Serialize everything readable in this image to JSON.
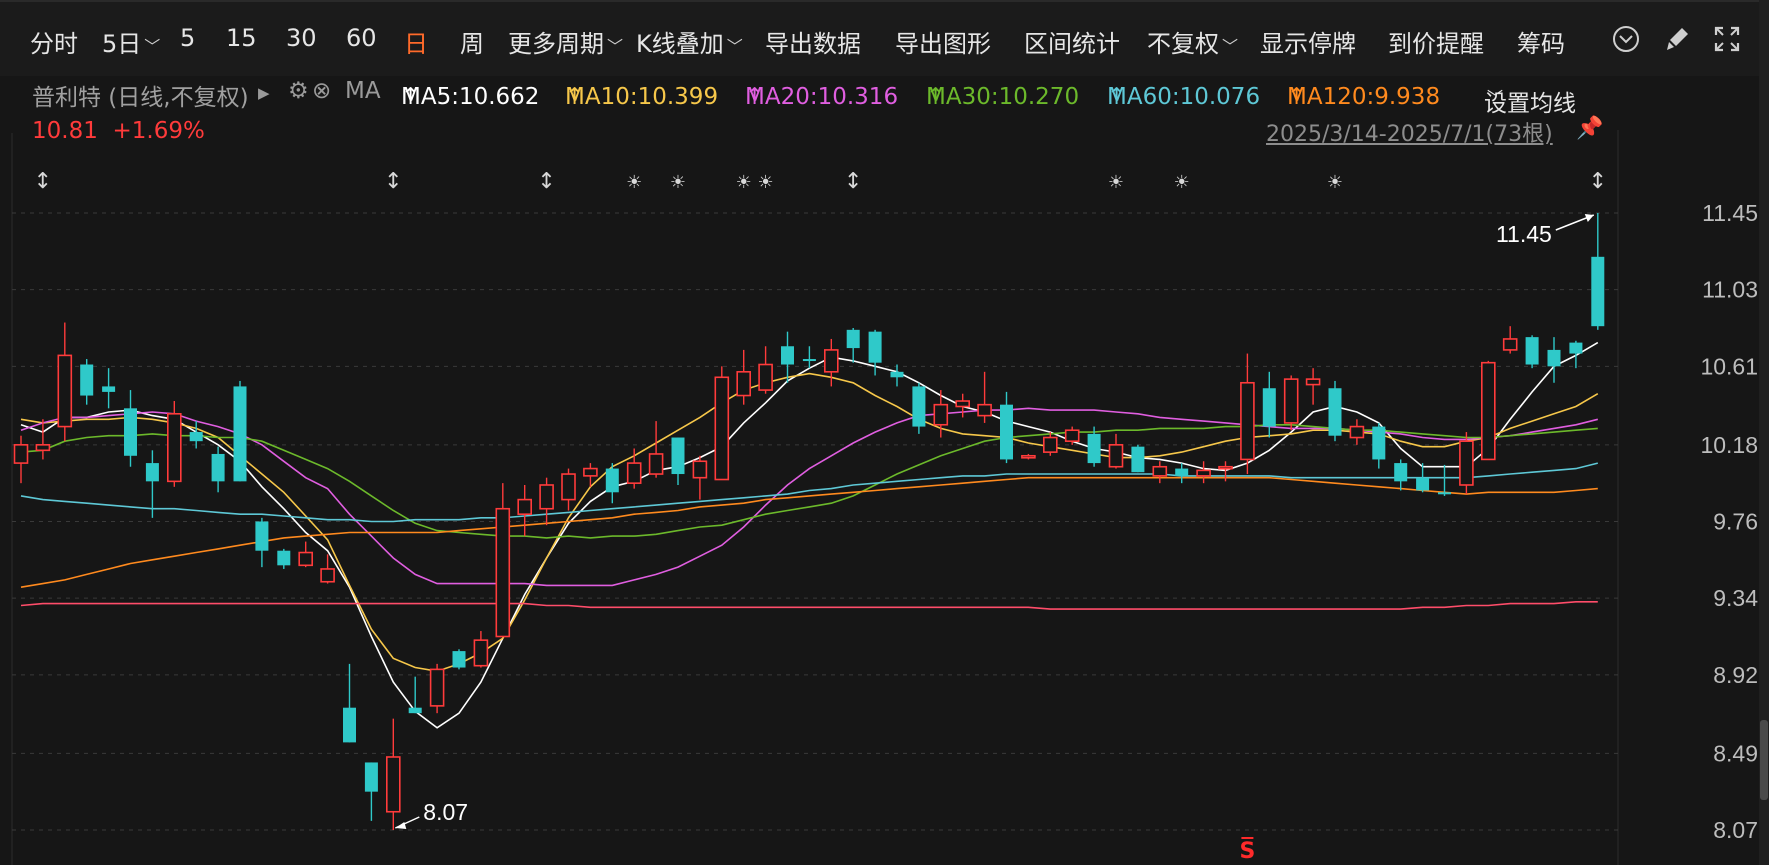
{
  "toolbar": {
    "items": [
      {
        "label": "分时",
        "chev": ""
      },
      {
        "label": "5日",
        "chev": "﹀"
      },
      {
        "label": "5",
        "chev": ""
      },
      {
        "label": "15",
        "chev": ""
      },
      {
        "label": "30",
        "chev": ""
      },
      {
        "label": "60",
        "chev": ""
      },
      {
        "label": "日",
        "chev": "",
        "active": true
      },
      {
        "label": "周",
        "chev": ""
      },
      {
        "label": "更多周期",
        "chev": "﹀"
      },
      {
        "label": "K线叠加",
        "chev": "﹀"
      },
      {
        "label": "导出数据",
        "chev": ""
      },
      {
        "label": "导出图形",
        "chev": ""
      },
      {
        "label": "区间统计",
        "chev": ""
      },
      {
        "label": "不复权",
        "chev": "﹀"
      },
      {
        "label": "显示停牌",
        "chev": ""
      },
      {
        "label": "到价提醒",
        "chev": ""
      },
      {
        "label": "筹码",
        "chev": ""
      }
    ],
    "icons": [
      "chevron-circle-icon",
      "brush-icon",
      "expand-icon"
    ]
  },
  "legend": {
    "stock": "普利特 (日线,不复权)",
    "ma_label": "MA",
    "settings": "设置均线",
    "mas": [
      {
        "text": "MA5:10.662",
        "color": "#ffffff"
      },
      {
        "text": "MA10:10.399",
        "color": "#f6c74a"
      },
      {
        "text": "MA20:10.316",
        "color": "#e05ee0"
      },
      {
        "text": "MA30:10.270",
        "color": "#6cb92b"
      },
      {
        "text": "MA60:10.076",
        "color": "#5ec8d6"
      },
      {
        "text": "MA120:9.938",
        "color": "#ff8a1e"
      }
    ]
  },
  "price": "10.81",
  "change": "+1.69%",
  "range_text": "2025/3/14-2025/7/1(73根)",
  "colors": {
    "up": "#ff3b3b",
    "down": "#2fc9c9",
    "grid": "#3a3a3a",
    "axis_text": "#bdbdbd"
  },
  "chart_data": {
    "type": "candlestick",
    "y_ticks": [
      11.45,
      11.03,
      10.61,
      10.18,
      9.76,
      9.34,
      8.92,
      8.49,
      8.07
    ],
    "ylim": [
      8.07,
      11.45
    ],
    "max_label": "11.45",
    "min_label": "8.07",
    "candles": [
      {
        "o": 10.08,
        "c": 10.18,
        "h": 10.23,
        "l": 9.97
      },
      {
        "o": 10.15,
        "c": 10.18,
        "h": 10.32,
        "l": 10.1
      },
      {
        "o": 10.28,
        "c": 10.67,
        "h": 10.85,
        "l": 10.2
      },
      {
        "o": 10.62,
        "c": 10.45,
        "h": 10.65,
        "l": 10.4
      },
      {
        "o": 10.5,
        "c": 10.47,
        "h": 10.6,
        "l": 10.38
      },
      {
        "o": 10.38,
        "c": 10.12,
        "h": 10.48,
        "l": 10.06
      },
      {
        "o": 10.08,
        "c": 9.98,
        "h": 10.15,
        "l": 9.78
      },
      {
        "o": 9.98,
        "c": 10.35,
        "h": 10.42,
        "l": 9.95
      },
      {
        "o": 10.25,
        "c": 10.2,
        "h": 10.31,
        "l": 10.16
      },
      {
        "o": 10.13,
        "c": 9.98,
        "h": 10.17,
        "l": 9.92
      },
      {
        "o": 10.5,
        "c": 9.98,
        "h": 10.53,
        "l": 9.98
      },
      {
        "o": 9.76,
        "c": 9.6,
        "h": 9.78,
        "l": 9.51
      },
      {
        "o": 9.6,
        "c": 9.52,
        "h": 9.61,
        "l": 9.5
      },
      {
        "o": 9.52,
        "c": 9.59,
        "h": 9.65,
        "l": 9.51
      },
      {
        "o": 9.43,
        "c": 9.5,
        "h": 9.58,
        "l": 9.42
      },
      {
        "o": 8.74,
        "c": 8.55,
        "h": 8.98,
        "l": 8.55
      },
      {
        "o": 8.44,
        "c": 8.28,
        "h": 8.44,
        "l": 8.12
      },
      {
        "o": 8.17,
        "c": 8.47,
        "h": 8.68,
        "l": 8.07
      },
      {
        "o": 8.74,
        "c": 8.71,
        "h": 8.91,
        "l": 8.71
      },
      {
        "o": 8.75,
        "c": 8.95,
        "h": 8.98,
        "l": 8.71
      },
      {
        "o": 9.05,
        "c": 8.96,
        "h": 9.06,
        "l": 8.95
      },
      {
        "o": 8.97,
        "c": 9.11,
        "h": 9.16,
        "l": 8.96
      },
      {
        "o": 9.13,
        "c": 9.83,
        "h": 9.97,
        "l": 9.13
      },
      {
        "o": 9.8,
        "c": 9.88,
        "h": 9.96,
        "l": 9.68
      },
      {
        "o": 9.83,
        "c": 9.96,
        "h": 10.0,
        "l": 9.74
      },
      {
        "o": 9.88,
        "c": 10.02,
        "h": 10.05,
        "l": 9.82
      },
      {
        "o": 10.01,
        "c": 10.05,
        "h": 10.08,
        "l": 9.95
      },
      {
        "o": 10.05,
        "c": 9.92,
        "h": 10.08,
        "l": 9.86
      },
      {
        "o": 9.97,
        "c": 10.08,
        "h": 10.16,
        "l": 9.94
      },
      {
        "o": 10.02,
        "c": 10.13,
        "h": 10.31,
        "l": 10.0
      },
      {
        "o": 10.22,
        "c": 10.02,
        "h": 10.22,
        "l": 9.96
      },
      {
        "o": 10.0,
        "c": 10.09,
        "h": 10.12,
        "l": 9.88
      },
      {
        "o": 9.99,
        "c": 10.55,
        "h": 10.61,
        "l": 9.99
      },
      {
        "o": 10.45,
        "c": 10.58,
        "h": 10.7,
        "l": 10.4
      },
      {
        "o": 10.48,
        "c": 10.62,
        "h": 10.72,
        "l": 10.46
      },
      {
        "o": 10.72,
        "c": 10.62,
        "h": 10.8,
        "l": 10.52
      },
      {
        "o": 10.65,
        "c": 10.64,
        "h": 10.72,
        "l": 10.6
      },
      {
        "o": 10.58,
        "c": 10.7,
        "h": 10.76,
        "l": 10.5
      },
      {
        "o": 10.81,
        "c": 10.71,
        "h": 10.82,
        "l": 10.63
      },
      {
        "o": 10.8,
        "c": 10.63,
        "h": 10.81,
        "l": 10.56
      },
      {
        "o": 10.58,
        "c": 10.55,
        "h": 10.62,
        "l": 10.5
      },
      {
        "o": 10.5,
        "c": 10.28,
        "h": 10.52,
        "l": 10.24
      },
      {
        "o": 10.29,
        "c": 10.4,
        "h": 10.48,
        "l": 10.22
      },
      {
        "o": 10.39,
        "c": 10.42,
        "h": 10.46,
        "l": 10.33
      },
      {
        "o": 10.34,
        "c": 10.4,
        "h": 10.58,
        "l": 10.3
      },
      {
        "o": 10.4,
        "c": 10.1,
        "h": 10.47,
        "l": 10.08
      },
      {
        "o": 10.12,
        "c": 10.12,
        "h": 10.13,
        "l": 10.1
      },
      {
        "o": 10.14,
        "c": 10.22,
        "h": 10.25,
        "l": 10.12
      },
      {
        "o": 10.2,
        "c": 10.26,
        "h": 10.28,
        "l": 10.18
      },
      {
        "o": 10.24,
        "c": 10.08,
        "h": 10.28,
        "l": 10.06
      },
      {
        "o": 10.06,
        "c": 10.18,
        "h": 10.24,
        "l": 10.05
      },
      {
        "o": 10.17,
        "c": 10.03,
        "h": 10.18,
        "l": 10.03
      },
      {
        "o": 10.01,
        "c": 10.06,
        "h": 10.09,
        "l": 9.97
      },
      {
        "o": 10.05,
        "c": 10.01,
        "h": 10.08,
        "l": 9.97
      },
      {
        "o": 10.01,
        "c": 10.04,
        "h": 10.09,
        "l": 9.97
      },
      {
        "o": 10.05,
        "c": 10.06,
        "h": 10.09,
        "l": 9.98
      },
      {
        "o": 10.1,
        "c": 10.52,
        "h": 10.68,
        "l": 10.02
      },
      {
        "o": 10.49,
        "c": 10.28,
        "h": 10.58,
        "l": 10.22
      },
      {
        "o": 10.3,
        "c": 10.54,
        "h": 10.56,
        "l": 10.26
      },
      {
        "o": 10.51,
        "c": 10.54,
        "h": 10.6,
        "l": 10.4
      },
      {
        "o": 10.49,
        "c": 10.23,
        "h": 10.53,
        "l": 10.2
      },
      {
        "o": 10.22,
        "c": 10.28,
        "h": 10.32,
        "l": 10.18
      },
      {
        "o": 10.28,
        "c": 10.1,
        "h": 10.3,
        "l": 10.05
      },
      {
        "o": 10.08,
        "c": 9.98,
        "h": 10.1,
        "l": 9.93
      },
      {
        "o": 10.0,
        "c": 9.93,
        "h": 10.08,
        "l": 9.92
      },
      {
        "o": 9.92,
        "c": 9.91,
        "h": 10.07,
        "l": 9.9
      },
      {
        "o": 9.96,
        "c": 10.2,
        "h": 10.25,
        "l": 9.91
      },
      {
        "o": 10.1,
        "c": 10.63,
        "h": 10.64,
        "l": 10.1
      },
      {
        "o": 10.7,
        "c": 10.76,
        "h": 10.83,
        "l": 10.68
      },
      {
        "o": 10.77,
        "c": 10.62,
        "h": 10.78,
        "l": 10.6
      },
      {
        "o": 10.7,
        "c": 10.61,
        "h": 10.77,
        "l": 10.52
      },
      {
        "o": 10.74,
        "c": 10.68,
        "h": 10.75,
        "l": 10.6
      },
      {
        "o": 11.21,
        "c": 10.83,
        "h": 11.45,
        "l": 10.81
      }
    ],
    "ma_series": [
      {
        "name": "MA5",
        "color": "#ffffff",
        "values": [
          10.29,
          10.25,
          10.33,
          10.33,
          10.36,
          10.37,
          10.34,
          10.32,
          10.25,
          10.18,
          10.09,
          9.95,
          9.83,
          9.7,
          9.6,
          9.4,
          9.13,
          8.88,
          8.72,
          8.63,
          8.71,
          8.88,
          9.12,
          9.36,
          9.56,
          9.75,
          9.87,
          9.95,
          9.98,
          10.04,
          10.06,
          10.11,
          10.17,
          10.3,
          10.41,
          10.53,
          10.6,
          10.66,
          10.64,
          10.61,
          10.58,
          10.52,
          10.45,
          10.39,
          10.36,
          10.31,
          10.28,
          10.25,
          10.2,
          10.16,
          10.14,
          10.11,
          10.1,
          10.08,
          10.05,
          10.04,
          10.08,
          10.15,
          10.25,
          10.36,
          10.39,
          10.36,
          10.3,
          10.16,
          10.06,
          10.06,
          10.06,
          10.16,
          10.32,
          10.47,
          10.61,
          10.67,
          10.74
        ]
      },
      {
        "name": "MA10",
        "color": "#f6c74a",
        "values": [
          10.32,
          10.3,
          10.31,
          10.32,
          10.32,
          10.33,
          10.32,
          10.3,
          10.27,
          10.22,
          10.12,
          10.02,
          9.92,
          9.79,
          9.66,
          9.41,
          9.17,
          9.01,
          8.96,
          8.94,
          8.98,
          9.04,
          9.12,
          9.33,
          9.56,
          9.78,
          9.95,
          10.06,
          10.12,
          10.19,
          10.26,
          10.33,
          10.41,
          10.48,
          10.52,
          10.55,
          10.57,
          10.55,
          10.52,
          10.45,
          10.39,
          10.32,
          10.27,
          10.24,
          10.23,
          10.22,
          10.19,
          10.17,
          10.15,
          10.13,
          10.11,
          10.11,
          10.12,
          10.14,
          10.17,
          10.2,
          10.22,
          10.23,
          10.24,
          10.26,
          10.26,
          10.25,
          10.24,
          10.2,
          10.17,
          10.17,
          10.2,
          10.22,
          10.27,
          10.31,
          10.35,
          10.39,
          10.46
        ]
      },
      {
        "name": "MA20",
        "color": "#e05ee0",
        "values": [
          10.26,
          10.3,
          10.33,
          10.33,
          10.34,
          10.35,
          10.36,
          10.35,
          10.31,
          10.28,
          10.24,
          10.18,
          10.09,
          10.0,
          9.94,
          9.8,
          9.68,
          9.56,
          9.47,
          9.42,
          9.42,
          9.42,
          9.42,
          9.42,
          9.41,
          9.41,
          9.41,
          9.41,
          9.44,
          9.47,
          9.51,
          9.57,
          9.63,
          9.73,
          9.85,
          9.96,
          10.05,
          10.12,
          10.19,
          10.25,
          10.3,
          10.34,
          10.35,
          10.36,
          10.37,
          10.37,
          10.38,
          10.37,
          10.37,
          10.37,
          10.36,
          10.35,
          10.33,
          10.32,
          10.31,
          10.3,
          10.29,
          10.28,
          10.27,
          10.27,
          10.27,
          10.26,
          10.25,
          10.24,
          10.22,
          10.21,
          10.21,
          10.22,
          10.23,
          10.25,
          10.27,
          10.29,
          10.32
        ]
      },
      {
        "name": "MA30",
        "color": "#6cb92b",
        "values": [
          10.14,
          10.15,
          10.2,
          10.22,
          10.23,
          10.23,
          10.24,
          10.23,
          10.23,
          10.22,
          10.22,
          10.2,
          10.15,
          10.1,
          10.05,
          9.98,
          9.9,
          9.82,
          9.75,
          9.71,
          9.7,
          9.69,
          9.68,
          9.68,
          9.67,
          9.68,
          9.67,
          9.68,
          9.68,
          9.69,
          9.71,
          9.73,
          9.74,
          9.77,
          9.8,
          9.82,
          9.84,
          9.86,
          9.9,
          9.96,
          10.02,
          10.07,
          10.12,
          10.16,
          10.2,
          10.22,
          10.23,
          10.24,
          10.25,
          10.25,
          10.26,
          10.26,
          10.27,
          10.27,
          10.27,
          10.28,
          10.28,
          10.29,
          10.29,
          10.28,
          10.27,
          10.26,
          10.26,
          10.25,
          10.24,
          10.23,
          10.22,
          10.22,
          10.23,
          10.24,
          10.25,
          10.26,
          10.27
        ]
      },
      {
        "name": "MA60",
        "color": "#5ec8d6",
        "values": [
          9.9,
          9.88,
          9.87,
          9.86,
          9.85,
          9.84,
          9.83,
          9.83,
          9.82,
          9.81,
          9.8,
          9.8,
          9.79,
          9.78,
          9.77,
          9.77,
          9.76,
          9.76,
          9.77,
          9.77,
          9.77,
          9.78,
          9.78,
          9.79,
          9.8,
          9.81,
          9.82,
          9.83,
          9.84,
          9.85,
          9.86,
          9.87,
          9.88,
          9.89,
          9.9,
          9.91,
          9.93,
          9.94,
          9.96,
          9.97,
          9.98,
          9.99,
          10.0,
          10.01,
          10.01,
          10.02,
          10.02,
          10.02,
          10.02,
          10.02,
          10.02,
          10.02,
          10.02,
          10.01,
          10.01,
          10.01,
          10.01,
          10.01,
          10.0,
          10.0,
          10.0,
          10.0,
          10.0,
          10.0,
          10.0,
          10.0,
          10.0,
          10.01,
          10.02,
          10.03,
          10.04,
          10.05,
          10.08
        ]
      },
      {
        "name": "MA120",
        "color": "#ff8a1e",
        "values": [
          9.4,
          9.42,
          9.44,
          9.47,
          9.5,
          9.53,
          9.55,
          9.57,
          9.59,
          9.61,
          9.63,
          9.65,
          9.67,
          9.68,
          9.69,
          9.7,
          9.7,
          9.7,
          9.7,
          9.7,
          9.71,
          9.72,
          9.73,
          9.74,
          9.75,
          9.76,
          9.77,
          9.78,
          9.8,
          9.81,
          9.82,
          9.84,
          9.85,
          9.86,
          9.88,
          9.89,
          9.9,
          9.91,
          9.92,
          9.93,
          9.94,
          9.95,
          9.96,
          9.97,
          9.98,
          9.99,
          10.0,
          10.0,
          10.0,
          10.0,
          10.0,
          10.0,
          10.0,
          10.0,
          10.0,
          10.0,
          10.0,
          10.0,
          9.99,
          9.98,
          9.97,
          9.96,
          9.95,
          9.94,
          9.93,
          9.92,
          9.91,
          9.92,
          9.92,
          9.92,
          9.92,
          9.93,
          9.94
        ]
      },
      {
        "name": "",
        "color": "#ff4d6a",
        "values": [
          9.3,
          9.31,
          9.31,
          9.31,
          9.31,
          9.31,
          9.31,
          9.31,
          9.31,
          9.31,
          9.31,
          9.31,
          9.31,
          9.31,
          9.31,
          9.31,
          9.31,
          9.31,
          9.31,
          9.31,
          9.31,
          9.31,
          9.31,
          9.31,
          9.3,
          9.3,
          9.29,
          9.29,
          9.29,
          9.29,
          9.29,
          9.29,
          9.29,
          9.29,
          9.29,
          9.29,
          9.29,
          9.29,
          9.29,
          9.29,
          9.29,
          9.29,
          9.29,
          9.29,
          9.29,
          9.29,
          9.29,
          9.28,
          9.28,
          9.28,
          9.28,
          9.28,
          9.28,
          9.28,
          9.28,
          9.28,
          9.28,
          9.28,
          9.28,
          9.28,
          9.28,
          9.28,
          9.28,
          9.28,
          9.29,
          9.29,
          9.3,
          9.3,
          9.31,
          9.31,
          9.31,
          9.32,
          9.32
        ]
      }
    ],
    "event_markers": [
      {
        "i": 1,
        "s": "↕"
      },
      {
        "i": 17,
        "s": "↕"
      },
      {
        "i": 24,
        "s": "↕"
      },
      {
        "i": 28,
        "s": "☀"
      },
      {
        "i": 30,
        "s": "☀"
      },
      {
        "i": 33,
        "s": "☀"
      },
      {
        "i": 34,
        "s": "☀"
      },
      {
        "i": 38,
        "s": "↕"
      },
      {
        "i": 50,
        "s": "☀"
      },
      {
        "i": 53,
        "s": "☀"
      },
      {
        "i": 60,
        "s": "☀"
      },
      {
        "i": 72,
        "s": "↕"
      }
    ],
    "s_marker_index": 56
  }
}
